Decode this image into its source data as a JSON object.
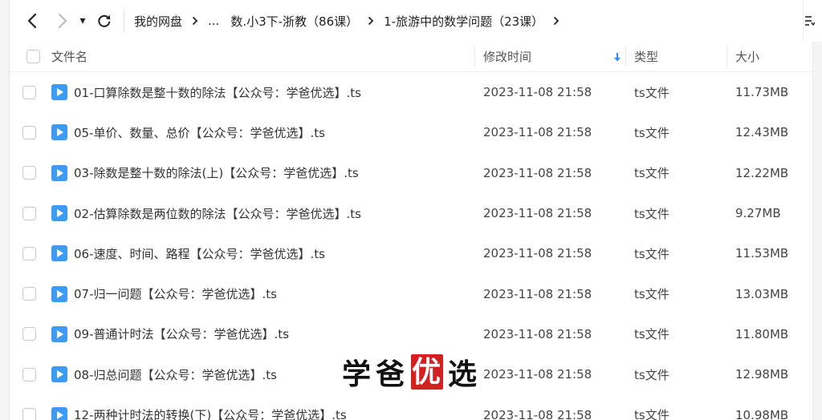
{
  "toolbar": {
    "dropdown_glyph": "▾",
    "breadcrumb": [
      {
        "label": "我的网盘"
      },
      {
        "label": "..."
      },
      {
        "label": "数.小3下-浙教（86课）"
      },
      {
        "label": "1-旅游中的数学问题（23课）"
      }
    ]
  },
  "columns": {
    "name": "文件名",
    "mtime": "修改时间",
    "type": "类型",
    "size": "大小"
  },
  "files": [
    {
      "name": "01-口算除数是整十数的除法【公众号：学爸优选】.ts",
      "mtime": "2023-11-08 21:58",
      "type": "ts文件",
      "size": "11.73MB"
    },
    {
      "name": "05-单价、数量、总价【公众号：学爸优选】.ts",
      "mtime": "2023-11-08 21:58",
      "type": "ts文件",
      "size": "12.43MB"
    },
    {
      "name": "03-除数是整十数的除法(上)【公众号：学爸优选】.ts",
      "mtime": "2023-11-08 21:58",
      "type": "ts文件",
      "size": "12.22MB"
    },
    {
      "name": "02-估算除数是两位数的除法【公众号：学爸优选】.ts",
      "mtime": "2023-11-08 21:58",
      "type": "ts文件",
      "size": "9.27MB"
    },
    {
      "name": "06-速度、时间、路程【公众号：学爸优选】.ts",
      "mtime": "2023-11-08 21:58",
      "type": "ts文件",
      "size": "11.53MB"
    },
    {
      "name": "07-归一问题【公众号：学爸优选】.ts",
      "mtime": "2023-11-08 21:58",
      "type": "ts文件",
      "size": "13.03MB"
    },
    {
      "name": "09-普通计时法【公众号：学爸优选】.ts",
      "mtime": "2023-11-08 21:58",
      "type": "ts文件",
      "size": "11.80MB"
    },
    {
      "name": "08-归总问题【公众号：学爸优选】.ts",
      "mtime": "2023-11-08 21:58",
      "type": "ts文件",
      "size": "12.98MB"
    },
    {
      "name": "12-两种计时法的转换(下)【公众号：学爸优选】.ts",
      "mtime": "2023-11-08 21:58",
      "type": "ts文件",
      "size": "10.98MB"
    }
  ],
  "watermark": {
    "c1": "学",
    "c2": "爸",
    "c3": "优",
    "c4": "选"
  },
  "colors": {
    "file_icon": "#3d9bf3",
    "sort_arrow": "#2f8cf0",
    "watermark_red": "#d32020"
  }
}
